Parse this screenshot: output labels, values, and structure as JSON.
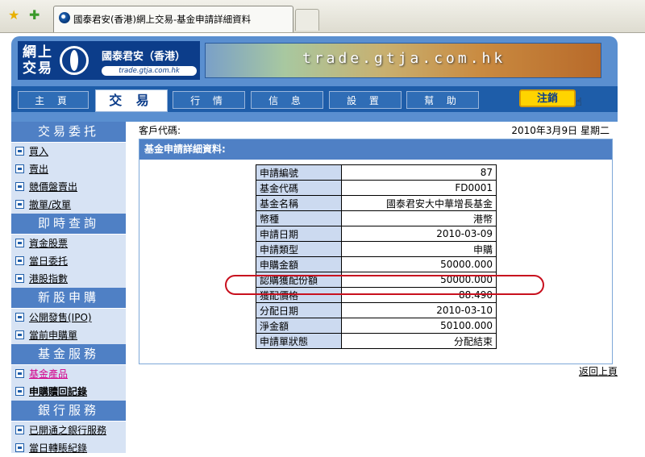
{
  "browser": {
    "tab_title": "國泰君安(香港)網上交易-基金申請詳細資料"
  },
  "header": {
    "logo_text_cn": "網上交易",
    "logo_company": "國泰君安（香港）",
    "logo_url": "trade.gtja.com.hk",
    "banner_url": "trade.gtja.com.hk",
    "nav": [
      "主 頁",
      "交 易",
      "行 情",
      "信 息",
      "設 置",
      "幫 助"
    ],
    "active_nav": "交 易",
    "logout_label": "注銷"
  },
  "sidebar": {
    "sections": [
      {
        "title": "交易委托",
        "items": [
          "買入",
          "賣出",
          "競價盤賣出",
          "撤單/改單"
        ]
      },
      {
        "title": "即時查詢",
        "items": [
          "資金股票",
          "當日委托",
          "港股指數"
        ]
      },
      {
        "title": "新股申購",
        "items": [
          "公開發售(IPO)",
          "當前申購單"
        ]
      },
      {
        "title": "基金服務",
        "items": [
          "基金產品",
          "申購贖回記錄"
        ]
      },
      {
        "title": "銀行服務",
        "items": [
          "已開通之銀行服務",
          "當日轉賬紀錄"
        ]
      }
    ]
  },
  "main": {
    "client_code_label": "客戶代碼:",
    "date": "2010年3月9日 星期二",
    "panel_title": "基金申請詳細資料:",
    "rows": [
      {
        "label": "申請編號",
        "value": "87"
      },
      {
        "label": "基金代碼",
        "value": "FD0001"
      },
      {
        "label": "基金名稱",
        "value": "國泰君安大中華增長基金"
      },
      {
        "label": "幣種",
        "value": "港幣"
      },
      {
        "label": "申請日期",
        "value": "2010-03-09"
      },
      {
        "label": "申請類型",
        "value": "申購"
      },
      {
        "label": "申購金額",
        "value": "50000.000"
      },
      {
        "label": "認購獲配份額",
        "value": "50000.000"
      },
      {
        "label": "獲配價格",
        "value": "88.490"
      },
      {
        "label": "分配日期",
        "value": "2010-03-10"
      },
      {
        "label": "淨金額",
        "value": "50100.000"
      },
      {
        "label": "申請單狀態",
        "value": "分配結束"
      }
    ],
    "back_link": "返回上頁"
  },
  "colors": {
    "nav_blue": "#1e5da9",
    "section_blue": "#4f80c5",
    "label_cell": "#ccdaf0",
    "highlight_red": "#c8101e",
    "active_link_pink": "#d4008a"
  }
}
